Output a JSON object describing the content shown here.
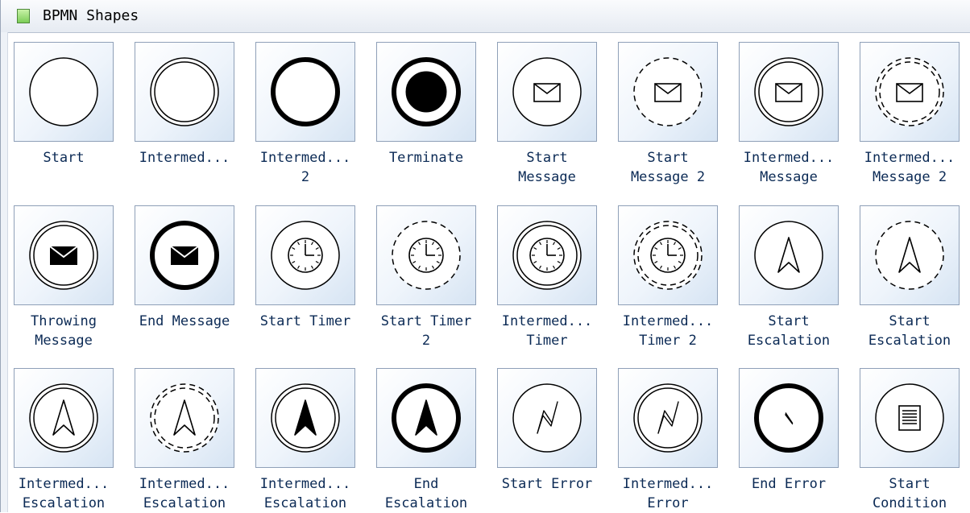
{
  "panel": {
    "title": "BPMN Shapes",
    "title_icon": "stencil-icon"
  },
  "shapes": [
    {
      "label": "Start",
      "icon": "start-event-icon"
    },
    {
      "label": "Intermed...",
      "icon": "intermediate-event-icon"
    },
    {
      "label": "Intermed...\n2",
      "icon": "intermediate-event-2-icon"
    },
    {
      "label": "Terminate",
      "icon": "terminate-event-icon"
    },
    {
      "label": "Start\nMessage",
      "icon": "start-message-icon"
    },
    {
      "label": "Start\nMessage 2",
      "icon": "start-message-2-icon"
    },
    {
      "label": "Intermed...\nMessage",
      "icon": "intermediate-message-icon"
    },
    {
      "label": "Intermed...\nMessage 2",
      "icon": "intermediate-message-2-icon"
    },
    {
      "label": "Throwing\nMessage",
      "icon": "throwing-message-icon"
    },
    {
      "label": "End Message",
      "icon": "end-message-icon"
    },
    {
      "label": "Start Timer",
      "icon": "start-timer-icon"
    },
    {
      "label": "Start Timer\n2",
      "icon": "start-timer-2-icon"
    },
    {
      "label": "Intermed...\nTimer",
      "icon": "intermediate-timer-icon"
    },
    {
      "label": "Intermed...\nTimer 2",
      "icon": "intermediate-timer-2-icon"
    },
    {
      "label": "Start\nEscalation",
      "icon": "start-escalation-icon"
    },
    {
      "label": "Start\nEscalation",
      "icon": "start-escalation-2-icon"
    },
    {
      "label": "Intermed...\nEscalation",
      "icon": "intermediate-escalation-icon"
    },
    {
      "label": "Intermed...\nEscalation",
      "icon": "intermediate-escalation-2-icon"
    },
    {
      "label": "Intermed...\nEscalation",
      "icon": "intermediate-escalation-throwing-icon"
    },
    {
      "label": "End\nEscalation",
      "icon": "end-escalation-icon"
    },
    {
      "label": "Start Error",
      "icon": "start-error-icon"
    },
    {
      "label": "Intermed...\nError",
      "icon": "intermediate-error-icon"
    },
    {
      "label": "End Error",
      "icon": "end-error-icon"
    },
    {
      "label": "Start\nCondition",
      "icon": "start-condition-icon"
    }
  ]
}
